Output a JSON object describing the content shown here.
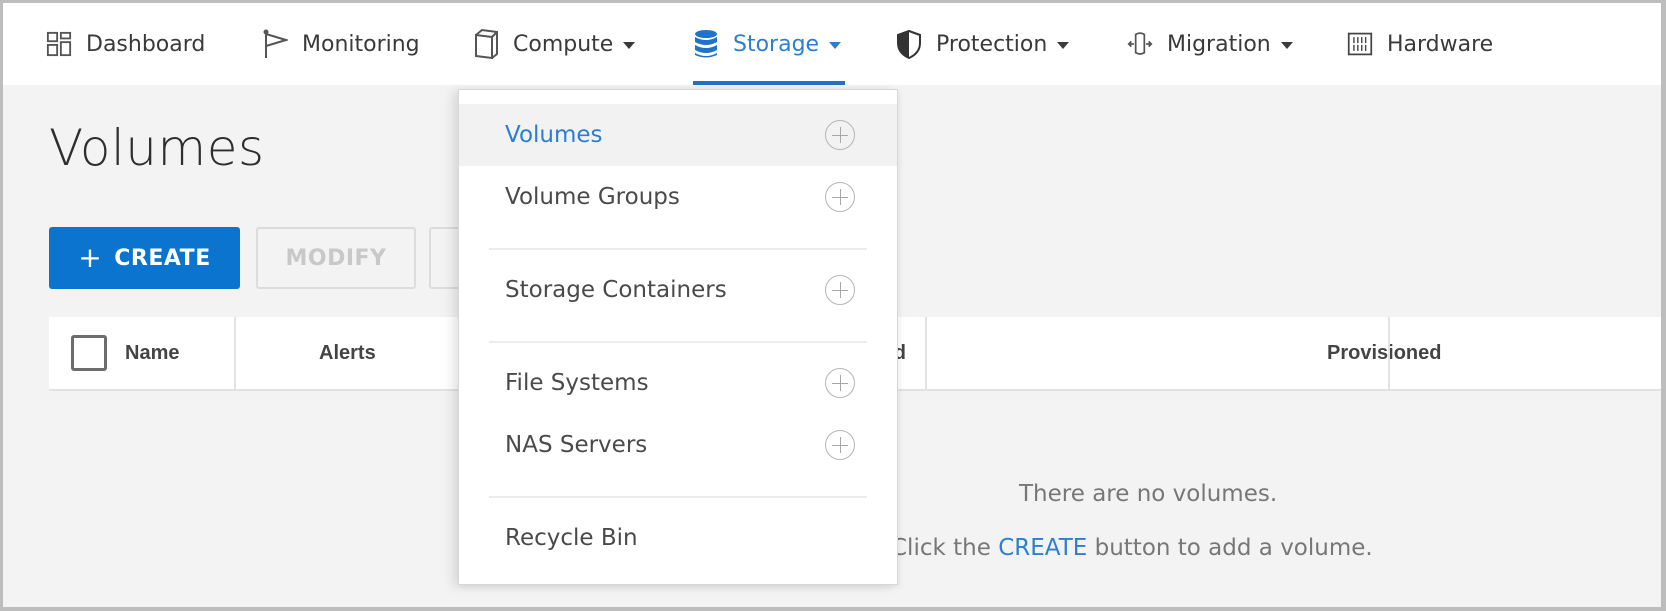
{
  "nav": {
    "items": [
      {
        "label": "Dashboard",
        "icon": "dashboard-grid-icon",
        "has_caret": false,
        "active": false
      },
      {
        "label": "Monitoring",
        "icon": "flag-icon",
        "has_caret": false,
        "active": false
      },
      {
        "label": "Compute",
        "icon": "compute-device-icon",
        "has_caret": true,
        "active": false
      },
      {
        "label": "Storage",
        "icon": "database-icon",
        "has_caret": true,
        "active": true
      },
      {
        "label": "Protection",
        "icon": "shield-icon",
        "has_caret": true,
        "active": false
      },
      {
        "label": "Migration",
        "icon": "migration-icon",
        "has_caret": true,
        "active": false
      },
      {
        "label": "Hardware",
        "icon": "hardware-rack-icon",
        "has_caret": false,
        "active": false
      }
    ],
    "accent_color": "#1f73c9"
  },
  "page": {
    "title": "Volumes"
  },
  "toolbar": {
    "create_plus": "+",
    "create_label": "CREATE",
    "modify_label": "MODIFY",
    "third_label": ""
  },
  "table": {
    "columns": [
      "Name",
      "Alerts",
      "Used",
      "Provisioned"
    ]
  },
  "empty_state": {
    "line1": "There are no volumes.",
    "line2_prefix": "Click the",
    "line2_link": "CREATE",
    "line2_suffix": "button to add a volume."
  },
  "storage_menu": {
    "items": [
      {
        "label": "Volumes",
        "has_add": true,
        "selected": true
      },
      {
        "label": "Volume Groups",
        "has_add": true,
        "selected": false
      },
      {
        "label": "Storage Containers",
        "has_add": true,
        "selected": false
      },
      {
        "label": "File Systems",
        "has_add": true,
        "selected": false
      },
      {
        "label": "NAS Servers",
        "has_add": true,
        "selected": false
      },
      {
        "label": "Recycle Bin",
        "has_add": false,
        "selected": false
      }
    ]
  },
  "colors": {
    "primary": "#0a74cf",
    "link": "#2a7fd4",
    "background": "#f3f3f3"
  }
}
